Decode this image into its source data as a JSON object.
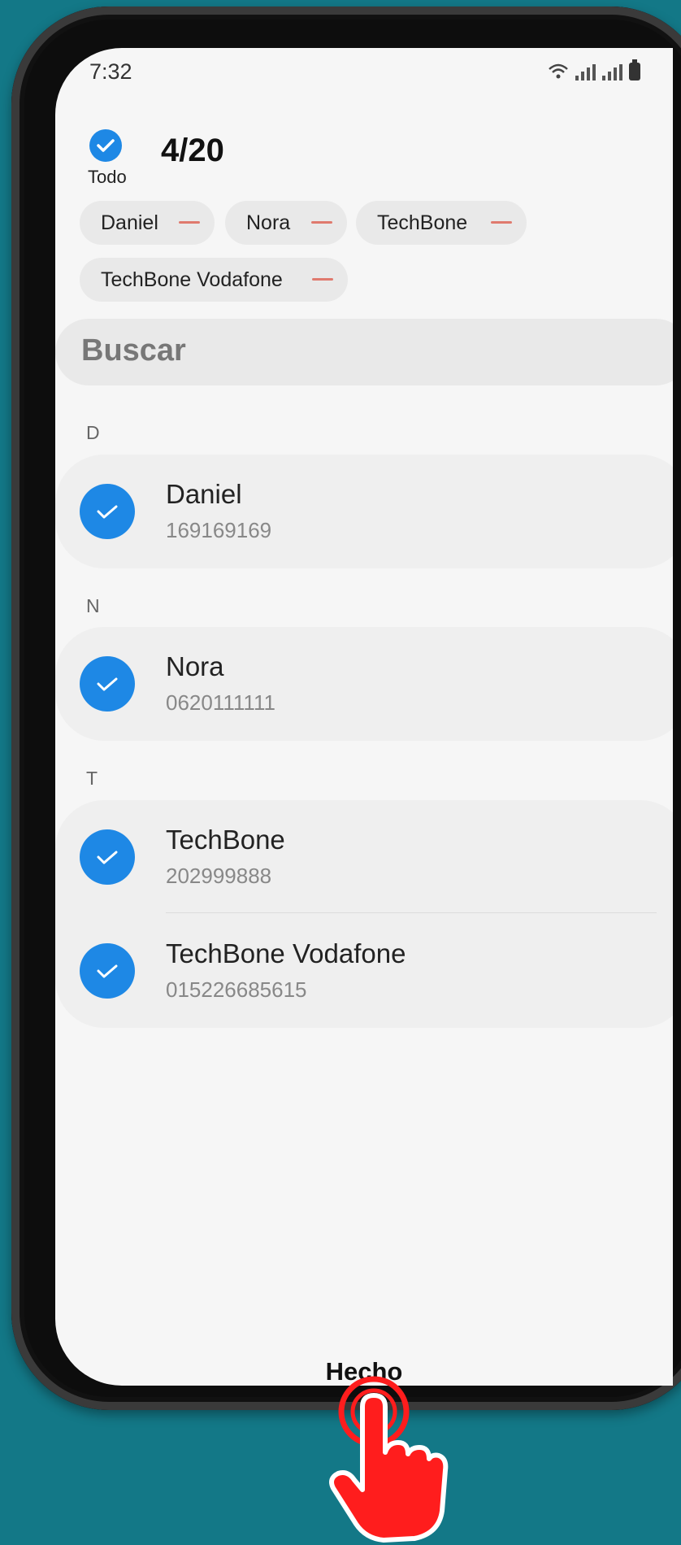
{
  "status_bar": {
    "time": "7:32"
  },
  "header": {
    "select_all_label": "Todo",
    "count": "4/20"
  },
  "chips": [
    {
      "label": "Daniel"
    },
    {
      "label": "Nora"
    },
    {
      "label": "TechBone"
    },
    {
      "label": "TechBone Vodafone"
    }
  ],
  "search": {
    "placeholder": "Buscar"
  },
  "sections": [
    {
      "letter": "D",
      "contacts": [
        {
          "name": "Daniel",
          "number": "169169169"
        }
      ]
    },
    {
      "letter": "N",
      "contacts": [
        {
          "name": "Nora",
          "number": "0620111111"
        }
      ]
    },
    {
      "letter": "T",
      "contacts": [
        {
          "name": "TechBone",
          "number": "202999888"
        },
        {
          "name": "TechBone Vodafone",
          "number": "015226685615"
        }
      ]
    }
  ],
  "footer": {
    "done_label": "Hecho"
  },
  "colors": {
    "accent": "#1e88e5",
    "background": "#137887",
    "pointer": "#ff1d1d"
  }
}
